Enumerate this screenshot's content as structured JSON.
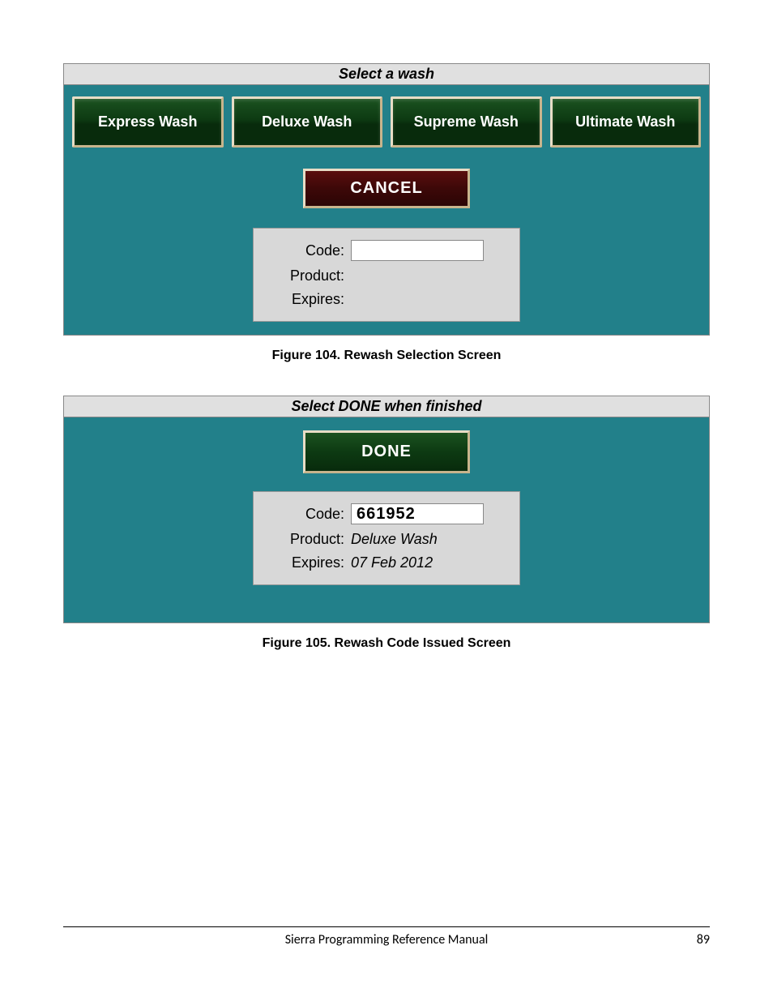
{
  "screen1": {
    "title": "Select a wash",
    "wash_options": [
      "Express Wash",
      "Deluxe Wash",
      "Supreme Wash",
      "Ultimate Wash"
    ],
    "cancel_label": "CANCEL",
    "info": {
      "code_label": "Code:",
      "code_value": "",
      "product_label": "Product:",
      "product_value": "",
      "expires_label": "Expires:",
      "expires_value": ""
    },
    "caption": "Figure 104. Rewash Selection Screen"
  },
  "screen2": {
    "title": "Select DONE when finished",
    "done_label": "DONE",
    "info": {
      "code_label": "Code:",
      "code_value": "661952",
      "product_label": "Product:",
      "product_value": "Deluxe Wash",
      "expires_label": "Expires:",
      "expires_value": "07 Feb 2012"
    },
    "caption": "Figure 105. Rewash Code Issued Screen"
  },
  "footer": {
    "title": "Sierra Programming Reference Manual",
    "page": "89"
  }
}
